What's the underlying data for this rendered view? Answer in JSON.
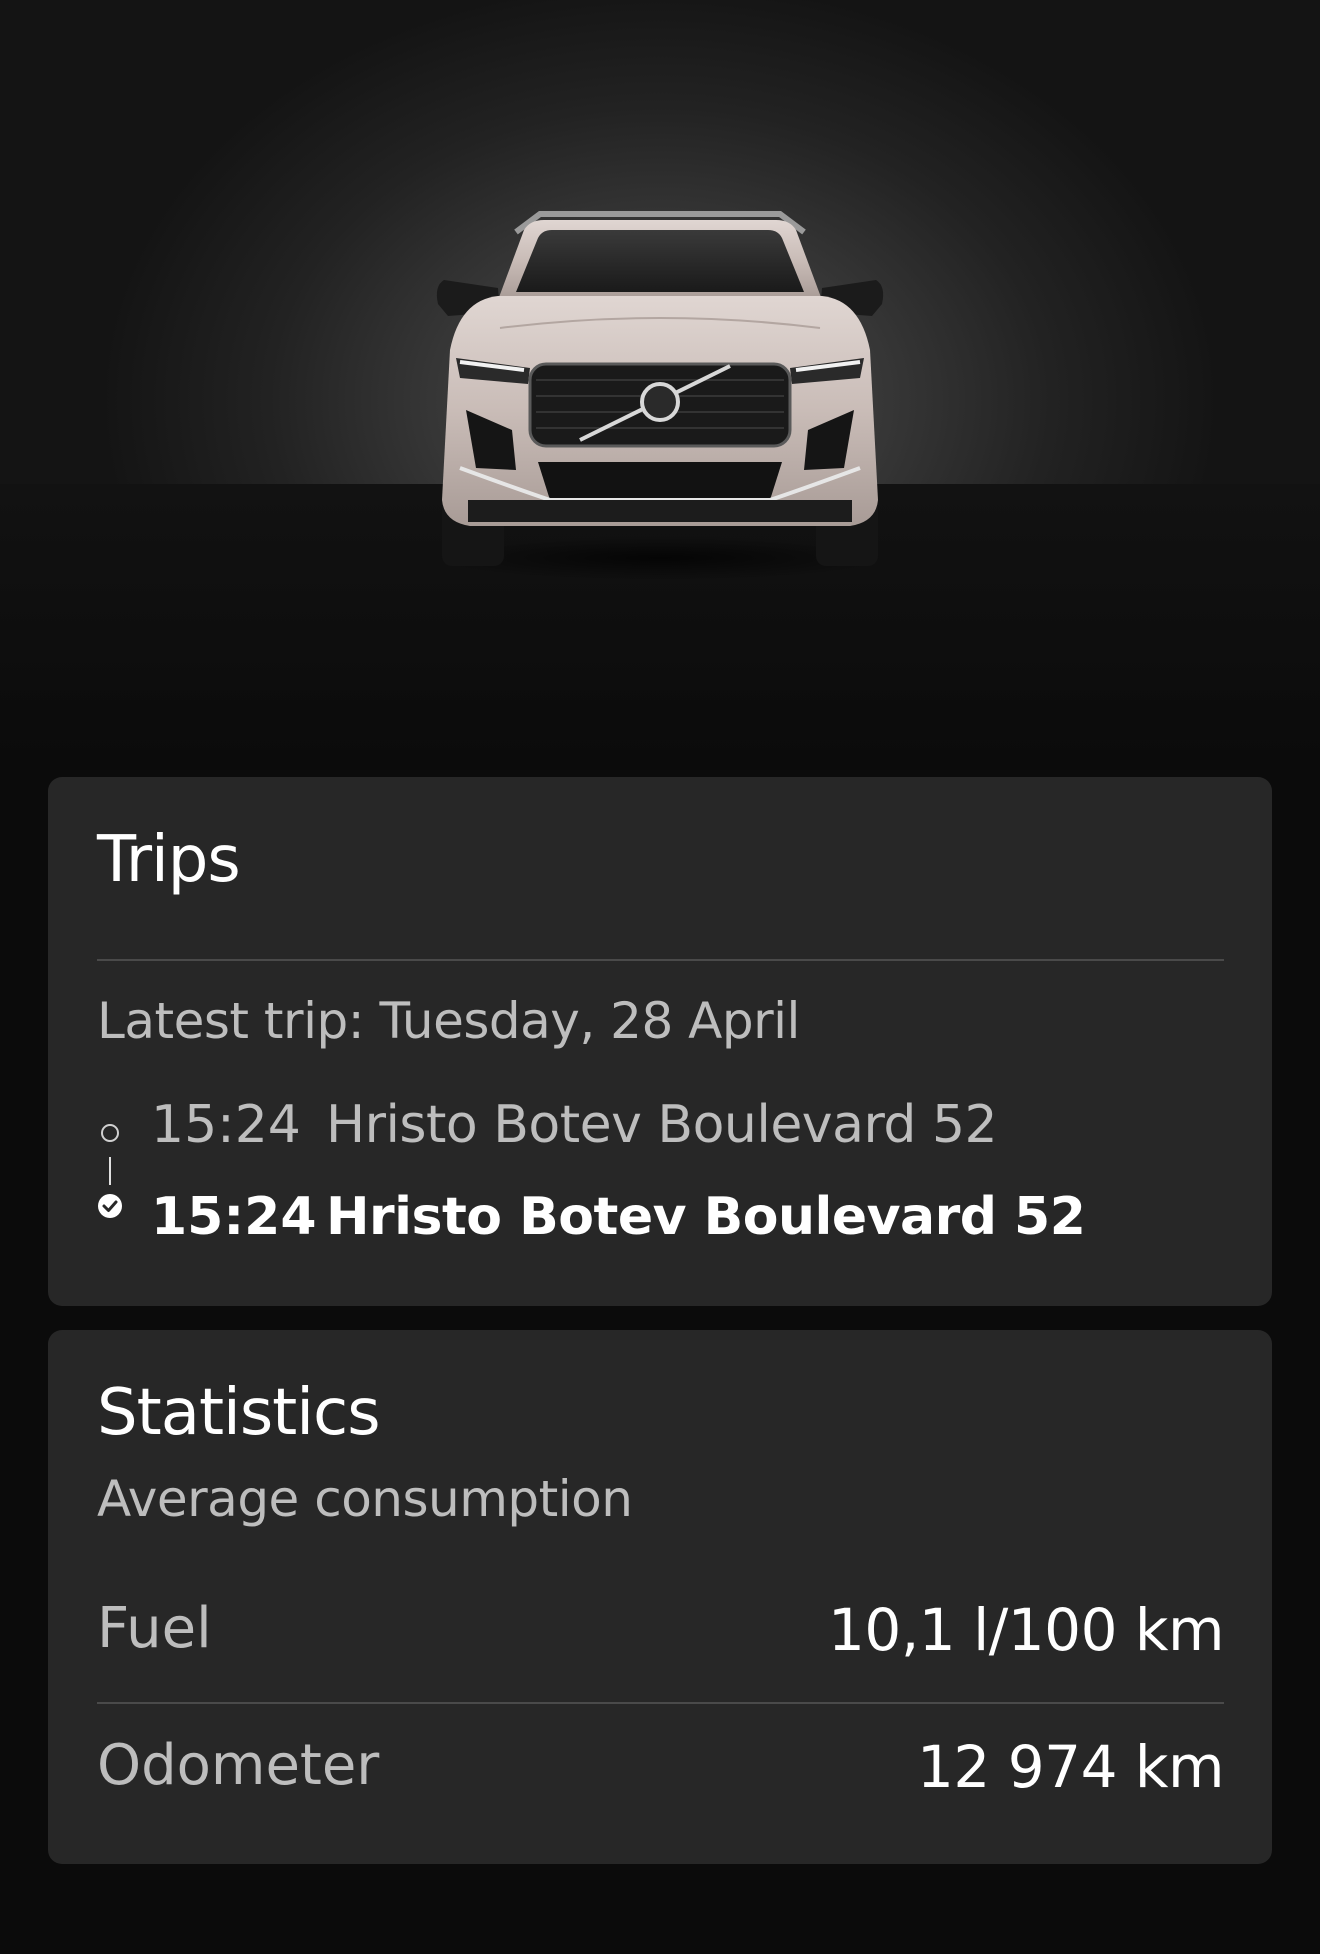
{
  "hero": {
    "image": "car-front-view"
  },
  "trips": {
    "title": "Trips",
    "latest_label": "Latest trip: Tuesday, 28 April",
    "start": {
      "time": "15:24",
      "address": "Hristo Botev Boulevard 52",
      "icon": "route-start-circle-icon"
    },
    "end": {
      "time": "15:24",
      "address": "Hristo Botev Boulevard 52",
      "icon": "route-end-check-icon"
    }
  },
  "statistics": {
    "title": "Statistics",
    "subtitle": "Average consumption",
    "rows": [
      {
        "label": "Fuel",
        "value": "10,1 l/100 km"
      },
      {
        "label": "Odometer",
        "value": "12 974 km"
      }
    ]
  },
  "colors": {
    "background": "#0b0b0b",
    "card": "#272727",
    "text_primary": "#ffffff",
    "text_secondary": "#bdbdbd",
    "divider": "#4a4a4a"
  }
}
